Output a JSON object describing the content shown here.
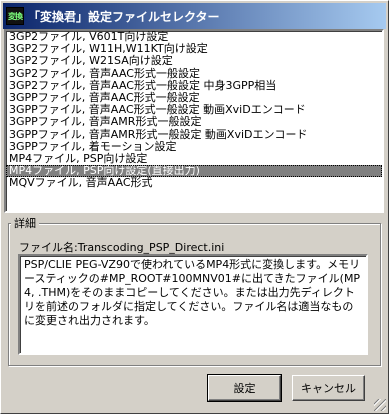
{
  "window": {
    "title": "「変換君」設定ファイルセレクター",
    "icon_name": "app-icon"
  },
  "preset_list": {
    "items": [
      "3GP2ファイル, V601T向け設定",
      "3GP2ファイル, W11H,W11KT向け設定",
      "3GP2ファイル, W21SA向け設定",
      "3GP2ファイル, 音声AAC形式一般設定",
      "3GP2ファイル, 音声AAC形式一般設定 中身3GPP相当",
      "3GPPファイル, 音声AAC形式一般設定",
      "3GPPファイル, 音声AAC形式一般設定 動画XviDエンコード",
      "3GPPファイル, 音声AMR形式一般設定",
      "3GPPファイル, 音声AMR形式一般設定 動画XviDエンコード",
      "3GPPファイル, 着モーション設定",
      "MP4ファイル, PSP向け設定",
      "MP4ファイル, PSP向け設定(直接出力)",
      "MQVファイル, 音声AAC形式"
    ],
    "selected_index": 11
  },
  "details": {
    "group_label": "詳細",
    "filename_label": "ファイル名:",
    "filename_value": "Transcoding_PSP_Direct.ini",
    "description": "PSP/CLIE PEG-VZ90で使われているMP4形式に変換します。メモリースティックの#MP_ROOT#100MNV01#に出てきたファイル(MP4, .THM)をそのままコピーしてください。または出力先ディレクトリを前述のフォルダに指定してください。ファイル名は適当なものに変更され出力されます。"
  },
  "buttons": {
    "ok_label": "設定",
    "cancel_label": "キャンセル"
  }
}
